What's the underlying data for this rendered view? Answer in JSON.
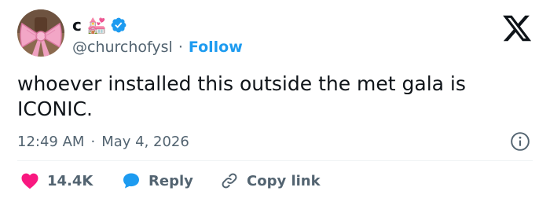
{
  "author": {
    "display_name": "c 💒",
    "handle": "@churchofysl",
    "follow_label": "Follow",
    "separator": "·"
  },
  "tweet": {
    "text": "whoever installed this outside the met gala is\nICONIC.",
    "time": "12:49 AM",
    "date": "May 4, 2026",
    "separator": "·"
  },
  "actions": {
    "like_count": "14.4K",
    "reply_label": "Reply",
    "copy_link_label": "Copy link"
  },
  "icons": {
    "logo": "x-logo-icon",
    "verified": "verified-badge-icon",
    "info": "info-icon",
    "like": "heart-icon",
    "reply": "speech-bubble-icon",
    "copy": "chain-link-icon"
  },
  "colors": {
    "text": "#0f1419",
    "secondary": "#536471",
    "accent": "#1d9bf0",
    "like": "#f91880",
    "divider": "#eff3f4"
  }
}
